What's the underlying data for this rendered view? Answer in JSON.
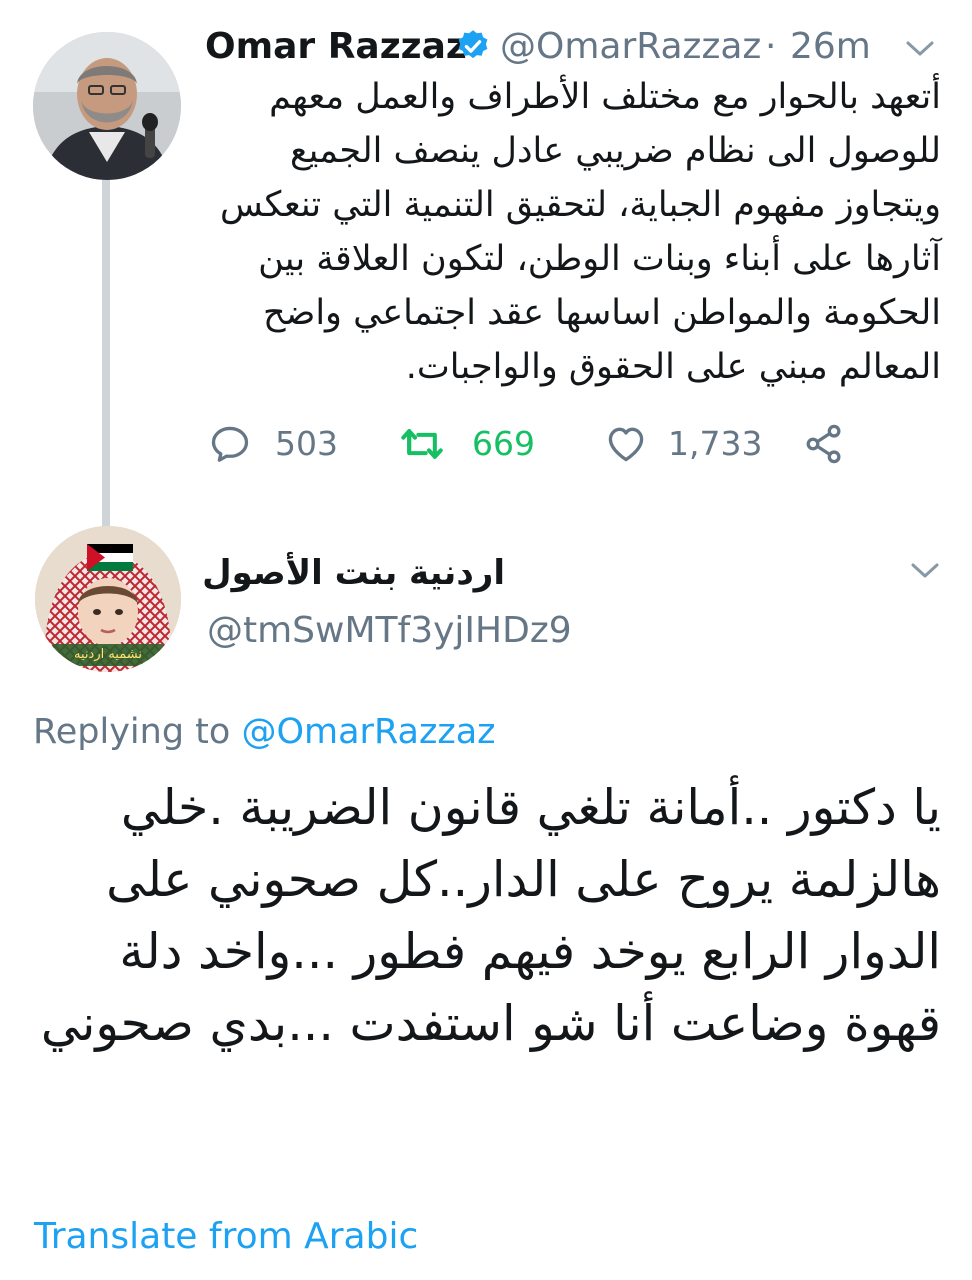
{
  "tweet": {
    "author_name": "Omar Razzaz",
    "handle": "@OmarRazzaz",
    "separator": "·",
    "time": "26m",
    "body": "أتعهد بالحوار مع مختلف الأطراف والعمل معهم للوصول الى نظام ضريبي عادل ينصف الجميع ويتجاوز مفهوم الجباية، لتحقيق التنمية التي تنعكس آثارها على أبناء وبنات الوطن، لتكون العلاقة بين الحكومة والمواطن اساسها عقد اجتماعي واضح المعالم مبني على الحقوق والواجبات.",
    "actions": {
      "replies": "503",
      "retweets": "669",
      "likes": "1,733"
    }
  },
  "reply": {
    "author_name": "اردنية  بنت الأصول",
    "handle": "@tmSwMTf3yjIHDz9",
    "avatar_caption": "نشميه اردنيه",
    "replying_label": "Replying to",
    "replying_handle": "@OmarRazzaz",
    "body": "يا دكتور  ..أمانة تلغي قانون الضريبة .خلي هالزلمة يروح على الدار..كل صحوني على الدوار الرابع يوخد فيهم فطور ...واخد دلة قهوة وضاعت أنا شو استفدت ...بدي صحوني",
    "translate_label": "Translate from Arabic"
  },
  "colors": {
    "text": "#14171a",
    "muted": "#657786",
    "link": "#1da1f2",
    "retweet": "#17bf63",
    "thread": "#cfd4d9"
  }
}
